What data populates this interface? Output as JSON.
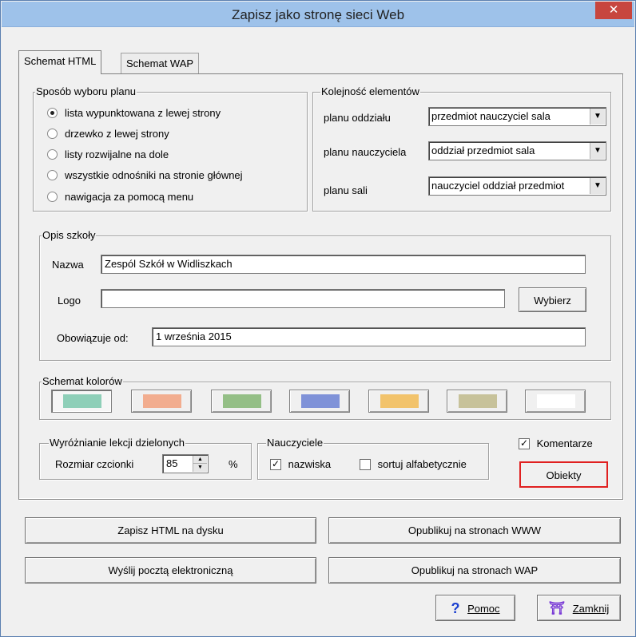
{
  "window": {
    "title": "Zapisz jako stronę sieci Web",
    "close_label": "✕"
  },
  "tabs": [
    {
      "label": "Schemat HTML"
    },
    {
      "label": "Schemat WAP"
    }
  ],
  "plan_selection": {
    "title": "Sposób wyboru planu",
    "options": [
      {
        "label": "lista wypunktowana z lewej strony",
        "selected": true
      },
      {
        "label": "drzewko z lewej strony",
        "selected": false
      },
      {
        "label": "listy rozwijalne na dole",
        "selected": false
      },
      {
        "label": "wszystkie odnośniki na stronie głównej",
        "selected": false
      },
      {
        "label": "nawigacja za pomocą menu",
        "selected": false
      }
    ]
  },
  "element_order": {
    "title": "Kolejność elementów",
    "rows": [
      {
        "label": "planu oddziału",
        "value": "przedmiot nauczyciel sala"
      },
      {
        "label": "planu nauczyciela",
        "value": "oddział przedmiot sala"
      },
      {
        "label": "planu sali",
        "value": "nauczyciel oddział przedmiot"
      }
    ]
  },
  "school": {
    "title": "Opis szkoły",
    "name_label": "Nazwa",
    "name_value": "Zespól Szkół w Widliszkach",
    "logo_label": "Logo",
    "logo_value": "",
    "choose_label": "Wybierz",
    "valid_from_label": "Obowiązuje od:",
    "valid_from_value": "1 września 2015"
  },
  "color_scheme": {
    "title": "Schemat kolorów",
    "swatches": [
      "#8ecfb8",
      "#f2ad8f",
      "#94bf86",
      "#7f92d8",
      "#f2c36b",
      "#c7c29a",
      "#ffffff"
    ]
  },
  "split_lessons": {
    "title": "Wyróżnianie lekcji dzielonych",
    "font_size_label": "Rozmiar czcionki",
    "font_size_value": "85",
    "unit": "%"
  },
  "teachers": {
    "title": "Nauczyciele",
    "surnames_label": "nazwiska",
    "surnames_checked": true,
    "sort_label": "sortuj alfabetycznie",
    "sort_checked": false
  },
  "comments": {
    "label": "Komentarze",
    "checked": true
  },
  "objects_button": "Obiekty",
  "actions": {
    "save_html": "Zapisz HTML na dysku",
    "publish_www": "Opublikuj na stronach WWW",
    "send_email": "Wyślij pocztą elektroniczną",
    "publish_wap": "Opublikuj na stronach WAP",
    "help": "Pomoc",
    "close": "Zamknij"
  },
  "colors": {
    "titlebar": "#9ec2ea",
    "close": "#c7463f",
    "highlight": "#e02020"
  }
}
